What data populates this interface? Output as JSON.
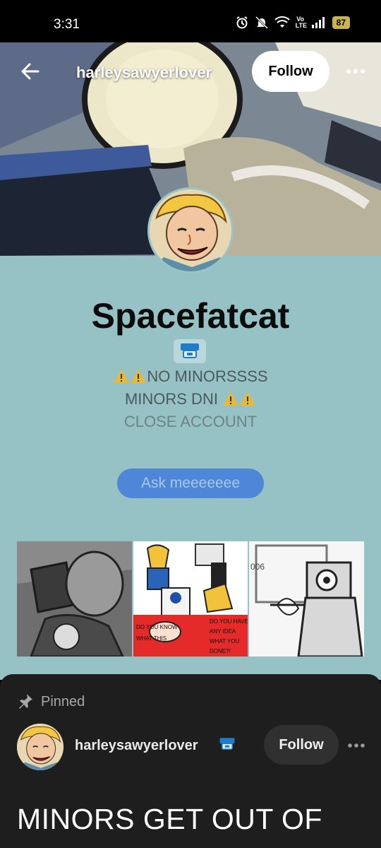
{
  "status_bar": {
    "time": "3:31",
    "volte": "Vo LTE",
    "battery": "87",
    "icons": [
      "alarm-icon",
      "mute-icon",
      "wifi-icon",
      "volte-icon",
      "signal-icon",
      "battery-icon"
    ]
  },
  "header": {
    "username": "harleysawyerlover",
    "follow_label": "Follow",
    "icons": [
      "back-arrow-icon",
      "more-options-icon"
    ]
  },
  "profile": {
    "title": "Spacefatcat",
    "description_line1": "NO MINORSSSS",
    "description_line2": "MINORS DNI",
    "description_line3": "CLOSE ACCOUNT",
    "ask_label": "Ask meeeeeee",
    "background_color": "#97c2c5",
    "ask_color": "#4e86d8"
  },
  "thumbnails": {
    "comic_text_1": "DO YOU KNOW WHAT THIS MEANS?!",
    "comic_text_2": "DO YOU HAVE ANY IDEA WHAT YOU HAVE DONE?!",
    "comic_text_3": "YOU"
  },
  "pinned_post": {
    "pinned_label": "Pinned",
    "username": "harleysawyerlover",
    "follow_label": "Follow",
    "text": "MINORS GET OUT OF",
    "icons": [
      "pin-icon",
      "avatar",
      "badge-icon",
      "more-options-icon"
    ]
  }
}
